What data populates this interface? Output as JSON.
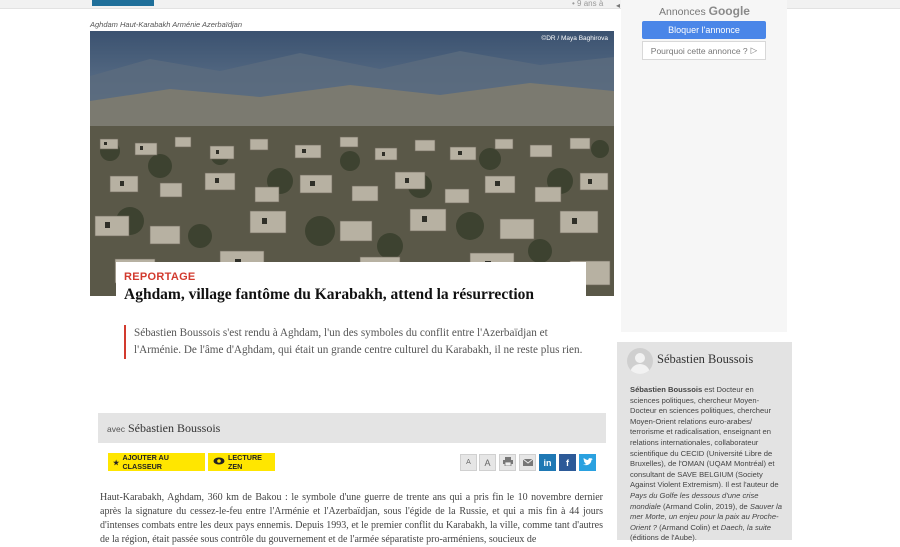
{
  "header": {
    "date_fragment": "• 9 ans à"
  },
  "photo": {
    "caption": "Aghdam Haut-Karabakh Arménie Azerbaïdjan",
    "credit": "©DR / Maya Baghirova"
  },
  "article": {
    "kicker": "REPORTAGE",
    "headline": "Aghdam, village fantôme du Karabakh, attend la résurrection",
    "chapo": "Sébastien Boussois s'est rendu à Aghdam, l'un des symboles du conflit entre l'Azerbaïdjan et l'Arménie. De l'âme d'Aghdam, qui était un grande centre culturel du Karabakh, il ne reste plus rien.",
    "avec": "avec",
    "author": "Sébastien Boussois",
    "body": "Haut-Karabakh, Aghdam, 360 km de Bakou : le symbole d'une guerre de trente ans qui a pris fin le 10 novembre dernier après la signature du cessez-le-feu entre l'Arménie et l'Azerbaïdjan, sous l'égide de la Russie, et qui a mis fin à 44 jours d'intenses combats entre les deux pays ennemis. Depuis 1993, et le premier conflit du Karabakh, la ville, comme tant d'autres de la région, était passée sous contrôle du gouvernement et de l'armée séparatiste pro-arméniens, soucieux de"
  },
  "toolbar": {
    "bookmark_label": "AJOUTER AU CLASSEUR",
    "zen_label": "LECTURE ZEN",
    "font_smaller": "A",
    "font_larger": "A",
    "print_icon": "print-icon",
    "mail_icon": "mail-icon",
    "linkedin_label": "in",
    "facebook_label": "f",
    "twitter_icon": "twitter-icon"
  },
  "ad": {
    "label": "Annonces",
    "brand": "Google",
    "block_label": "Bloquer l'annonce",
    "why_label": "Pourquoi cette annonce ?"
  },
  "author_card": {
    "name": "Sébastien Boussois",
    "bio_name": "Sébastien Boussois",
    "bio_text": " est Docteur en sciences politiques, chercheur Moyen-Docteur en sciences politiques, chercheur Moyen-Orient relations euro-arabes/ terrorisme et radicalisation, enseignant en relations internationales, collaborateur scientifique du CECID (Université Libre de Bruxelles), de l'OMAN (UQAM Montréal) et consultant de SAVE BELGIUM (Society Against Violent Extremism). Il est l'auteur de ",
    "book1": "Pays du Golfe les dessous d'une crise mondiale",
    "bio_text2": " (Armand Colin, 2019), de ",
    "book2": "Sauver la mer Morte, un enjeu pour la paix au Proche-Orient ?",
    "bio_text3": " (Armand Colin) et ",
    "book3": "Daech, la suite",
    "bio_text4": " (éditions de l'Aube)."
  },
  "colors": {
    "accent_red": "#d23a2e",
    "highlight_yellow": "#ffe600",
    "linkedin": "#1e78b4",
    "facebook": "#2d5a98",
    "twitter": "#2aa1e0",
    "ad_button": "#4a86e8"
  }
}
